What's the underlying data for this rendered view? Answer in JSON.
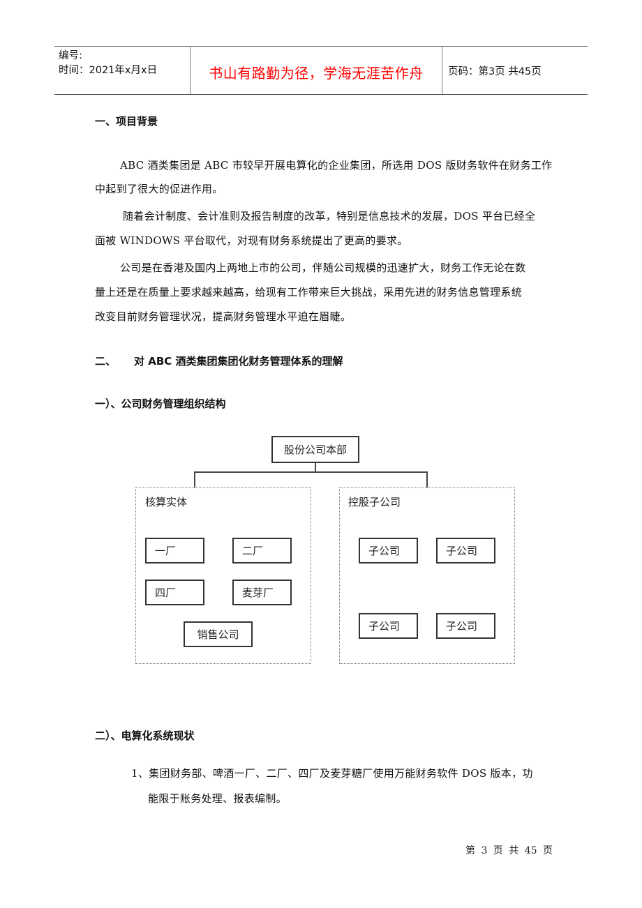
{
  "header": {
    "number_label": "编号:",
    "date_label": "时间：2021年x月x日",
    "motto": "书山有路勤为径，学海无涯苦作舟",
    "page_info": "页码：第3页 共45页"
  },
  "section1": {
    "title": "一、项目背景",
    "paragraphs": [
      [
        "ABC 酒类集团是 ABC 市较早开展电算化的企业集团，所选用 DOS 版财务软件在财务工作",
        "中起到了很大的促进作用。"
      ],
      [
        "随着会计制度、会计准则及报告制度的改革，特别是信息技术的发展，DOS 平台已经全",
        "面被 WINDOWS 平台取代，对现有财务系统提出了更高的要求。"
      ],
      [
        "公司是在香港及国内上两地上市的公司，伴随公司规模的迅速扩大，财务工作无论在数",
        "量上还是在质量上要求越来越高，给现有工作带来巨大挑战，采用先进的财务信息管理系统",
        "改变目前财务管理状况，提高财务管理水平迫在眉睫。"
      ]
    ]
  },
  "section2": {
    "number": "二、",
    "title": "对 ABC 酒类集团集团化财务管理体系的理解",
    "sub1": {
      "title": "一）、公司财务管理组织结构",
      "org_chart": {
        "root": "股份公司本部",
        "groups": [
          {
            "title": "核算实体",
            "units": [
              "一厂",
              "二厂",
              "四厂",
              "麦芽厂",
              "销售公司"
            ]
          },
          {
            "title": "控股子公司",
            "units": [
              "子公司",
              "子公司",
              "子公司",
              "子公司"
            ]
          }
        ]
      }
    },
    "sub2": {
      "title": "二）、电算化系统现状",
      "items": [
        {
          "lines": [
            "1、集团财务部、啤酒一厂、二厂、四厂及麦芽糖厂使用万能财务软件 DOS 版本，功",
            "能限于账务处理、报表编制。"
          ]
        }
      ]
    }
  },
  "footer": {
    "page_text": "第 3 页 共 45 页"
  }
}
